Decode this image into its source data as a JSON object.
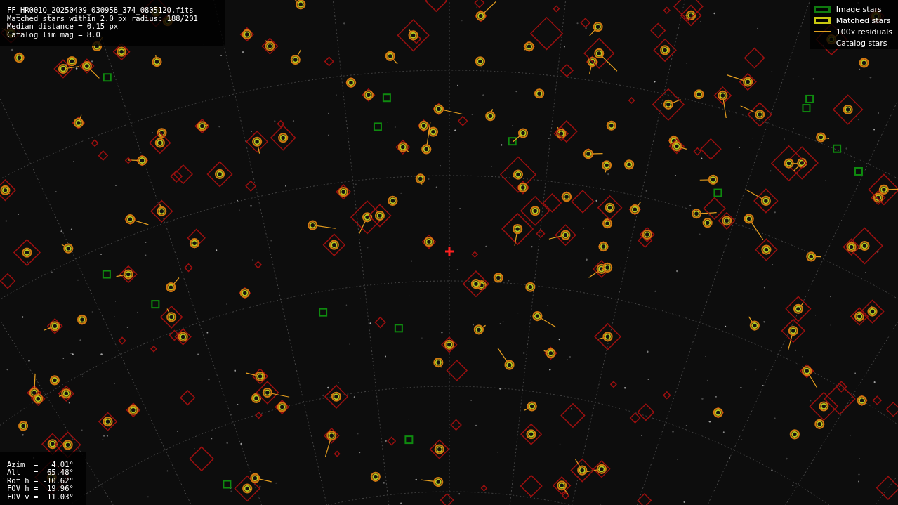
{
  "header": {
    "lines": [
      "FF_HR001Q_20250409_030958_374_0805120.fits",
      "Matched stars within 2.0 px radius: 188/201",
      "Median distance = 0.15 px",
      "Catalog lim mag = 8.0"
    ]
  },
  "legend": [
    {
      "label": "Image stars",
      "kind": "box",
      "color": "#0f7a0f"
    },
    {
      "label": "Matched stars",
      "kind": "box",
      "color": "#c8c810"
    },
    {
      "label": "100x residuals",
      "kind": "line",
      "color": "#e0a020"
    },
    {
      "label": "Catalog stars",
      "kind": "none"
    }
  ],
  "pointing": {
    "lines": [
      "Azim  =   4.01°",
      "Alt   =  65.48°",
      "Rot h = -10.62°",
      "FOV h =  19.96°",
      "FOV v =  11.03°"
    ]
  }
}
